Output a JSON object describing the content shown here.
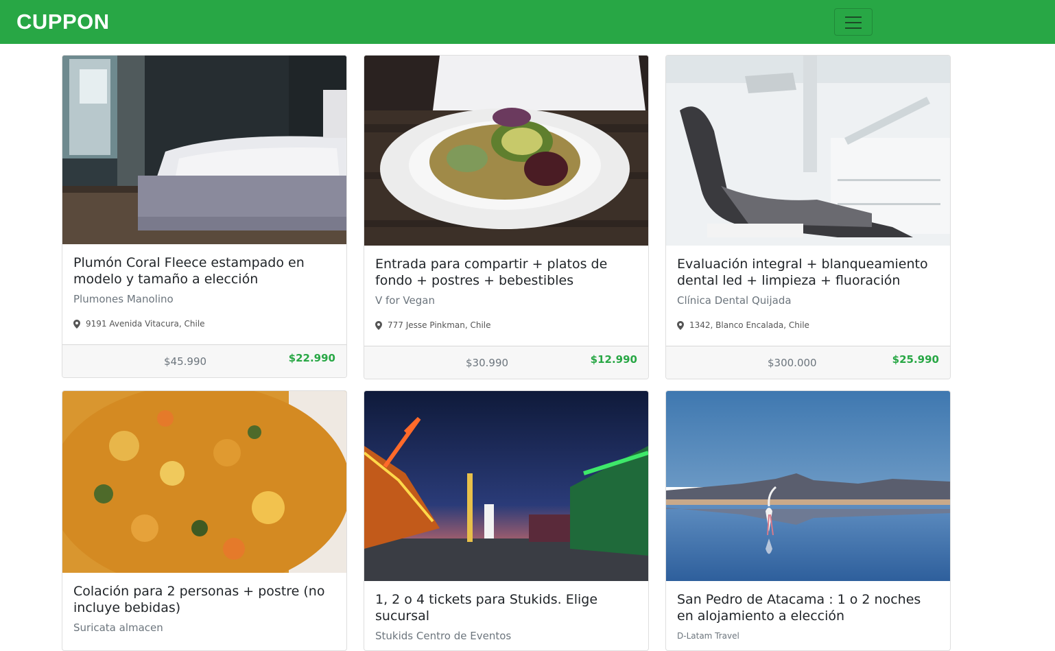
{
  "header": {
    "brand": "CUPPON",
    "menu_icon": "hamburger-menu-icon",
    "background": "#28a745"
  },
  "deals": [
    {
      "title": "Plumón Coral Fleece estampado en modelo y tamaño a elección",
      "merchant": "Plumones Manolino",
      "address": "9191 Avenida Vitacura, Chile",
      "old_price": "$45.990",
      "new_price": "$22.990",
      "image": "bedroom-photo"
    },
    {
      "title": "Entrada para compartir + platos de fondo + postres + bebestibles",
      "merchant": "V for Vegan",
      "address": "777 Jesse Pinkman, Chile",
      "old_price": "$30.990",
      "new_price": "$12.990",
      "image": "vegan-salad-photo"
    },
    {
      "title": "Evaluación integral + blanqueamiento dental led + limpieza + fluoración",
      "merchant": "Clínica Dental Quijada",
      "address": "1342, Blanco Encalada, Chile",
      "old_price": "$300.000",
      "new_price": "$25.990",
      "image": "dental-chair-photo"
    },
    {
      "title": "Colación para 2 personas + postre (no incluye bebidas)",
      "merchant": "Suricata almacen",
      "image": "food-dish-photo"
    },
    {
      "title": "1, 2 o 4 tickets para Stukids. Elige sucursal",
      "merchant": "Stukids Centro de Eventos",
      "image": "fair-rides-night-photo"
    },
    {
      "title": "San Pedro de Atacama : 1 o 2 noches en alojamiento a elección",
      "merchant": "D-Latam Travel",
      "image": "flamingo-lake-photo"
    }
  ]
}
